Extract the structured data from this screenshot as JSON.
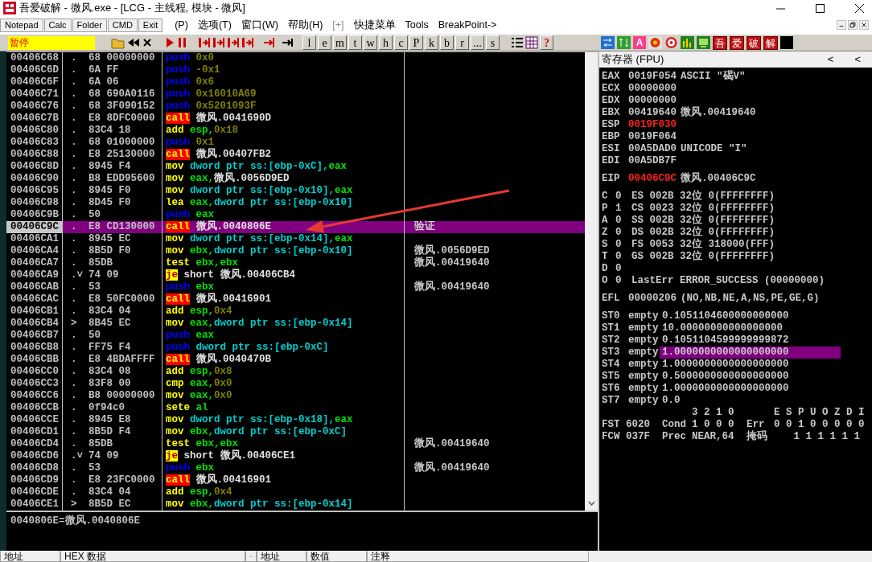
{
  "window": {
    "title": "吾爱破解 - 微风.exe - [LCG - 主线程, 模块 - 微风]"
  },
  "menu": {
    "quick_buttons": [
      "Notepad",
      "Calc",
      "Folder",
      "CMD",
      "Exit"
    ],
    "items": [
      {
        "label": "(P)",
        "disabled": false
      },
      {
        "label": "选项(T)",
        "disabled": false
      },
      {
        "label": "窗口(W)",
        "disabled": false
      },
      {
        "label": "帮助(H)",
        "disabled": false
      },
      {
        "label": "[+]",
        "disabled": true
      },
      {
        "label": "快捷菜单",
        "disabled": false
      },
      {
        "label": "Tools",
        "disabled": false
      },
      {
        "label": "BreakPoint->",
        "disabled": false
      }
    ]
  },
  "toolbar": {
    "status": "暂停",
    "letters": [
      "l",
      "e",
      "m",
      "t",
      "w",
      "h",
      "c",
      "P",
      "k",
      "b",
      "r",
      "...",
      "s"
    ],
    "help": "?",
    "highlight": "A",
    "brand": [
      "吾",
      "爱",
      "破",
      "解"
    ]
  },
  "disassembly": {
    "rows": [
      {
        "address": "00406C68",
        "marker": ".",
        "hex": "68 00000000",
        "mnemonic": "push",
        "kind": "push",
        "operands": [
          {
            "text": "0x0",
            "kind": "imm"
          }
        ],
        "selected": false
      },
      {
        "address": "00406C6D",
        "marker": ".",
        "hex": "6A FF",
        "mnemonic": "push",
        "kind": "push",
        "operands": [
          {
            "text": "-0x1",
            "kind": "imm"
          }
        ],
        "selected": false
      },
      {
        "address": "00406C6F",
        "marker": ".",
        "hex": "6A 06",
        "mnemonic": "push",
        "kind": "push",
        "operands": [
          {
            "text": "0x6",
            "kind": "imm"
          }
        ],
        "selected": false
      },
      {
        "address": "00406C71",
        "marker": ".",
        "hex": "68 690A0116",
        "mnemonic": "push",
        "kind": "push",
        "operands": [
          {
            "text": "0x16010A69",
            "kind": "imm"
          }
        ],
        "selected": false
      },
      {
        "address": "00406C76",
        "marker": ".",
        "hex": "68 3F090152",
        "mnemonic": "push",
        "kind": "push",
        "operands": [
          {
            "text": "0x5201093F",
            "kind": "imm"
          }
        ],
        "selected": false
      },
      {
        "address": "00406C7B",
        "marker": ".",
        "hex": "E8 8DFC0000",
        "mnemonic": "call",
        "kind": "call",
        "operands": [
          {
            "text": "微风.0041690D",
            "kind": "sym"
          }
        ],
        "selected": false
      },
      {
        "address": "00406C80",
        "marker": ".",
        "hex": "83C4 18",
        "mnemonic": "add",
        "kind": "op",
        "operands": [
          {
            "text": "esp,",
            "kind": "reg"
          },
          {
            "text": "0x18",
            "kind": "imm"
          }
        ],
        "selected": false
      },
      {
        "address": "00406C83",
        "marker": ".",
        "hex": "68 01000000",
        "mnemonic": "push",
        "kind": "push",
        "operands": [
          {
            "text": "0x1",
            "kind": "imm"
          }
        ],
        "selected": false
      },
      {
        "address": "00406C88",
        "marker": ".",
        "hex": "E8 25130000",
        "mnemonic": "call",
        "kind": "call",
        "operands": [
          {
            "text": "微风.00407FB2",
            "kind": "sym"
          }
        ],
        "selected": false
      },
      {
        "address": "00406C8D",
        "marker": ".",
        "hex": "8945 F4",
        "mnemonic": "mov",
        "kind": "op",
        "operands": [
          {
            "text": "dword ptr ss:[ebp-0xC],",
            "kind": "mem"
          },
          {
            "text": "eax",
            "kind": "reg"
          }
        ],
        "selected": false
      },
      {
        "address": "00406C90",
        "marker": ".",
        "hex": "B8 EDD95600",
        "mnemonic": "mov",
        "kind": "op",
        "operands": [
          {
            "text": "eax,",
            "kind": "reg"
          },
          {
            "text": "微风.0056D9ED",
            "kind": "sym"
          }
        ],
        "selected": false
      },
      {
        "address": "00406C95",
        "marker": ".",
        "hex": "8945 F0",
        "mnemonic": "mov",
        "kind": "op",
        "operands": [
          {
            "text": "dword ptr ss:[ebp-0x10],",
            "kind": "mem"
          },
          {
            "text": "eax",
            "kind": "reg"
          }
        ],
        "selected": false
      },
      {
        "address": "00406C98",
        "marker": ".",
        "hex": "8D45 F0",
        "mnemonic": "lea",
        "kind": "op",
        "operands": [
          {
            "text": "eax,",
            "kind": "reg"
          },
          {
            "text": "dword ptr ss:[ebp-0x10]",
            "kind": "mem"
          }
        ],
        "selected": false
      },
      {
        "address": "00406C9B",
        "marker": ".",
        "hex": "50",
        "mnemonic": "push",
        "kind": "push",
        "operands": [
          {
            "text": "eax",
            "kind": "reg"
          }
        ],
        "selected": false
      },
      {
        "address": "00406C9C",
        "marker": ".",
        "hex": "E8 CD130000",
        "mnemonic": "call",
        "kind": "call",
        "operands": [
          {
            "text": "微风.0040806E",
            "kind": "sym"
          }
        ],
        "comment": "验证",
        "selected": true
      },
      {
        "address": "00406CA1",
        "marker": ".",
        "hex": "8945 EC",
        "mnemonic": "mov",
        "kind": "op",
        "operands": [
          {
            "text": "dword ptr ss:[ebp-0x14],",
            "kind": "mem"
          },
          {
            "text": "eax",
            "kind": "reg"
          }
        ],
        "selected": false
      },
      {
        "address": "00406CA4",
        "marker": ".",
        "hex": "8B5D F0",
        "mnemonic": "mov",
        "kind": "op",
        "operands": [
          {
            "text": "ebx,",
            "kind": "reg"
          },
          {
            "text": "dword ptr ss:[ebp-0x10]",
            "kind": "mem"
          }
        ],
        "comment": "微风.0056D9ED",
        "selected": false
      },
      {
        "address": "00406CA7",
        "marker": ".",
        "hex": "85DB",
        "mnemonic": "test",
        "kind": "op",
        "operands": [
          {
            "text": "ebx,ebx",
            "kind": "reg"
          }
        ],
        "comment": "微风.00419640",
        "selected": false
      },
      {
        "address": "00406CA9",
        "marker": ".˅",
        "hex": "74 09",
        "mnemonic": "je",
        "kind": "jump",
        "operands": [
          {
            "text": "short 微风.00406CB4",
            "kind": "sym"
          }
        ],
        "selected": false
      },
      {
        "address": "00406CAB",
        "marker": ".",
        "hex": "53",
        "mnemonic": "push",
        "kind": "push",
        "operands": [
          {
            "text": "ebx",
            "kind": "reg"
          }
        ],
        "comment": "微风.00419640",
        "selected": false
      },
      {
        "address": "00406CAC",
        "marker": ".",
        "hex": "E8 50FC0000",
        "mnemonic": "call",
        "kind": "call",
        "operands": [
          {
            "text": "微风.00416901",
            "kind": "sym"
          }
        ],
        "selected": false
      },
      {
        "address": "00406CB1",
        "marker": ".",
        "hex": "83C4 04",
        "mnemonic": "add",
        "kind": "op",
        "operands": [
          {
            "text": "esp,",
            "kind": "reg"
          },
          {
            "text": "0x4",
            "kind": "imm"
          }
        ],
        "selected": false
      },
      {
        "address": "00406CB4",
        "marker": ">",
        "hex": "8B45 EC",
        "mnemonic": "mov",
        "kind": "op",
        "operands": [
          {
            "text": "eax,",
            "kind": "reg"
          },
          {
            "text": "dword ptr ss:[ebp-0x14]",
            "kind": "mem"
          }
        ],
        "selected": false
      },
      {
        "address": "00406CB7",
        "marker": ".",
        "hex": "50",
        "mnemonic": "push",
        "kind": "push",
        "operands": [
          {
            "text": "eax",
            "kind": "reg"
          }
        ],
        "selected": false
      },
      {
        "address": "00406CB8",
        "marker": ".",
        "hex": "FF75 F4",
        "mnemonic": "push",
        "kind": "push",
        "operands": [
          {
            "text": "dword ptr ss:[ebp-0xC]",
            "kind": "mem"
          }
        ],
        "selected": false
      },
      {
        "address": "00406CBB",
        "marker": ".",
        "hex": "E8 4BDAFFFF",
        "mnemonic": "call",
        "kind": "call",
        "operands": [
          {
            "text": "微风.0040470B",
            "kind": "sym"
          }
        ],
        "selected": false
      },
      {
        "address": "00406CC0",
        "marker": ".",
        "hex": "83C4 08",
        "mnemonic": "add",
        "kind": "op",
        "operands": [
          {
            "text": "esp,",
            "kind": "reg"
          },
          {
            "text": "0x8",
            "kind": "imm"
          }
        ],
        "selected": false
      },
      {
        "address": "00406CC3",
        "marker": ".",
        "hex": "83F8 00",
        "mnemonic": "cmp",
        "kind": "op",
        "operands": [
          {
            "text": "eax,",
            "kind": "reg"
          },
          {
            "text": "0x0",
            "kind": "imm"
          }
        ],
        "selected": false
      },
      {
        "address": "00406CC6",
        "marker": ".",
        "hex": "B8 00000000",
        "mnemonic": "mov",
        "kind": "op",
        "operands": [
          {
            "text": "eax,",
            "kind": "reg"
          },
          {
            "text": "0x0",
            "kind": "imm"
          }
        ],
        "selected": false
      },
      {
        "address": "00406CCB",
        "marker": ".",
        "hex": "0f94c0",
        "mnemonic": "sete",
        "kind": "op",
        "operands": [
          {
            "text": "al",
            "kind": "reg"
          }
        ],
        "selected": false
      },
      {
        "address": "00406CCE",
        "marker": ".",
        "hex": "8945 E8",
        "mnemonic": "mov",
        "kind": "op",
        "operands": [
          {
            "text": "dword ptr ss:[ebp-0x18],",
            "kind": "mem"
          },
          {
            "text": "eax",
            "kind": "reg"
          }
        ],
        "selected": false
      },
      {
        "address": "00406CD1",
        "marker": ".",
        "hex": "8B5D F4",
        "mnemonic": "mov",
        "kind": "op",
        "operands": [
          {
            "text": "ebx,",
            "kind": "reg"
          },
          {
            "text": "dword ptr ss:[ebp-0xC]",
            "kind": "mem"
          }
        ],
        "selected": false
      },
      {
        "address": "00406CD4",
        "marker": ".",
        "hex": "85DB",
        "mnemonic": "test",
        "kind": "op",
        "operands": [
          {
            "text": "ebx,ebx",
            "kind": "reg"
          }
        ],
        "comment": "微风.00419640",
        "selected": false
      },
      {
        "address": "00406CD6",
        "marker": ".˅",
        "hex": "74 09",
        "mnemonic": "je",
        "kind": "jump",
        "operands": [
          {
            "text": "short 微风.00406CE1",
            "kind": "sym"
          }
        ],
        "selected": false
      },
      {
        "address": "00406CD8",
        "marker": ".",
        "hex": "53",
        "mnemonic": "push",
        "kind": "push",
        "operands": [
          {
            "text": "ebx",
            "kind": "reg"
          }
        ],
        "comment": "微风.00419640",
        "selected": false
      },
      {
        "address": "00406CD9",
        "marker": ".",
        "hex": "E8 23FC0000",
        "mnemonic": "call",
        "kind": "call",
        "operands": [
          {
            "text": "微风.00416901",
            "kind": "sym"
          }
        ],
        "selected": false
      },
      {
        "address": "00406CDE",
        "marker": ".",
        "hex": "83C4 04",
        "mnemonic": "add",
        "kind": "op",
        "operands": [
          {
            "text": "esp,",
            "kind": "reg"
          },
          {
            "text": "0x4",
            "kind": "imm"
          }
        ],
        "selected": false
      },
      {
        "address": "00406CE1",
        "marker": ">",
        "hex": "8B5D EC",
        "mnemonic": "mov",
        "kind": "op",
        "operands": [
          {
            "text": "ebx,",
            "kind": "reg"
          },
          {
            "text": "dword ptr ss:[ebp-0x14]",
            "kind": "mem"
          }
        ],
        "selected": false
      }
    ]
  },
  "info": "0040806E=微风.0040806E",
  "registers": {
    "title": "寄存器 (FPU)",
    "nav": [
      "<",
      "<"
    ],
    "general": [
      {
        "name": "EAX",
        "value": "0019F054",
        "changed": false,
        "note": "ASCII \"碣V\""
      },
      {
        "name": "ECX",
        "value": "00000000",
        "changed": false
      },
      {
        "name": "EDX",
        "value": "00000000",
        "changed": false
      },
      {
        "name": "EBX",
        "value": "00419640",
        "changed": false,
        "note": "微风.00419640"
      },
      {
        "name": "ESP",
        "value": "0019F030",
        "changed": true
      },
      {
        "name": "EBP",
        "value": "0019F064",
        "changed": false
      },
      {
        "name": "ESI",
        "value": "00A5DAD0",
        "changed": false,
        "note": "UNICODE \"I\""
      },
      {
        "name": "EDI",
        "value": "00A5DB7F",
        "changed": false
      }
    ],
    "eip": {
      "name": "EIP",
      "value": "00406C9C",
      "changed": true,
      "note": "微风.00406C9C"
    },
    "flags": [
      {
        "flag": "C",
        "value": "0",
        "segment": "ES 002B 32位 0(FFFFFFFF)"
      },
      {
        "flag": "P",
        "value": "1",
        "segment": "CS 0023 32位 0(FFFFFFFF)"
      },
      {
        "flag": "A",
        "value": "0",
        "segment": "SS 002B 32位 0(FFFFFFFF)"
      },
      {
        "flag": "Z",
        "value": "0",
        "segment": "DS 002B 32位 0(FFFFFFFF)"
      },
      {
        "flag": "S",
        "value": "0",
        "segment": "FS 0053 32位 318000(FFF)"
      },
      {
        "flag": "T",
        "value": "0",
        "segment": "GS 002B 32位 0(FFFFFFFF)"
      },
      {
        "flag": "D",
        "value": "0"
      },
      {
        "flag": "O",
        "value": "0",
        "segment": "LastErr ERROR_SUCCESS (00000000)"
      }
    ],
    "efl": {
      "name": "EFL",
      "value": "00000206",
      "note": "(NO,NB,NE,A,NS,PE,GE,G)"
    },
    "fpu": [
      {
        "name": "ST0",
        "tag": "empty",
        "value": "0.1051104600000000000",
        "selected": false
      },
      {
        "name": "ST1",
        "tag": "empty",
        "value": "10.00000000000000000",
        "selected": false
      },
      {
        "name": "ST2",
        "tag": "empty",
        "value": "0.1051104599999999872",
        "selected": false
      },
      {
        "name": "ST3",
        "tag": "empty",
        "value": "1.0000000000000000000",
        "selected": true
      },
      {
        "name": "ST4",
        "tag": "empty",
        "value": "1.0000000000000000000",
        "selected": false
      },
      {
        "name": "ST5",
        "tag": "empty",
        "value": "0.5000000000000000000",
        "selected": false
      },
      {
        "name": "ST6",
        "tag": "empty",
        "value": "1.0000000000000000000",
        "selected": false
      },
      {
        "name": "ST7",
        "tag": "empty",
        "value": "0.0",
        "selected": false
      }
    ],
    "fpu_status": {
      "cond_bits": "3 2 1 0",
      "err_bits": "E S P U O Z D I",
      "fst": {
        "label": "FST 6020",
        "cond_label": "Cond",
        "cond": "1 0 0 0",
        "err_label": "Err",
        "err": "0 0 1 0 0 0 0 0"
      },
      "fcw": {
        "label": "FCW 037F",
        "prec_label": "Prec",
        "prec": "NEAR,64",
        "mask_label": "掩码",
        "mask": "1 1 1 1 1 1"
      }
    }
  },
  "bottom_panes": {
    "dump_headers": [
      "地址",
      "HEX 数据"
    ],
    "stack_headers": [
      "地址",
      "数值",
      "注释"
    ]
  }
}
